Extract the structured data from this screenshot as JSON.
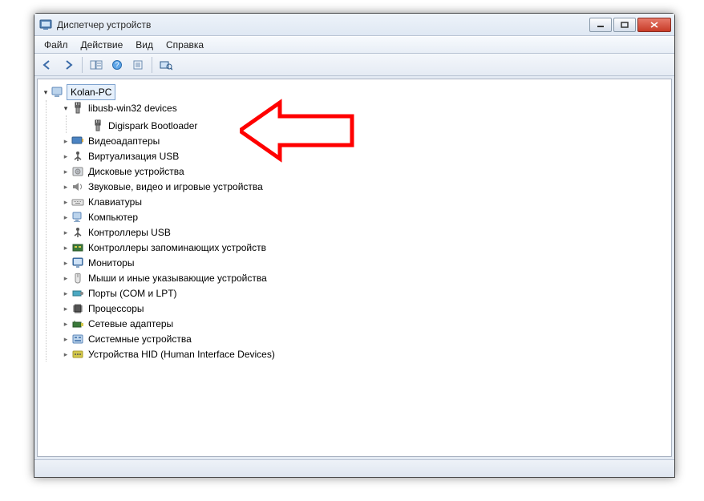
{
  "title": "Диспетчер устройств",
  "menu": {
    "file": "Файл",
    "action": "Действие",
    "view": "Вид",
    "help": "Справка"
  },
  "tree": {
    "root": "Kolan-PC",
    "items": [
      {
        "label": "libusb-win32 devices",
        "icon": "usb-plug-icon",
        "expanded": true,
        "children": [
          {
            "label": "Digispark Bootloader",
            "icon": "usb-plug-icon"
          }
        ]
      },
      {
        "label": "Видеоадаптеры",
        "icon": "display-adapter-icon"
      },
      {
        "label": "Виртуализация USB",
        "icon": "usb-controller-icon"
      },
      {
        "label": "Дисковые устройства",
        "icon": "disk-drive-icon"
      },
      {
        "label": "Звуковые, видео и игровые устройства",
        "icon": "sound-icon"
      },
      {
        "label": "Клавиатуры",
        "icon": "keyboard-icon"
      },
      {
        "label": "Компьютер",
        "icon": "computer-icon"
      },
      {
        "label": "Контроллеры USB",
        "icon": "usb-controller-icon"
      },
      {
        "label": "Контроллеры запоминающих устройств",
        "icon": "storage-controller-icon"
      },
      {
        "label": "Мониторы",
        "icon": "monitor-icon"
      },
      {
        "label": "Мыши и иные указывающие устройства",
        "icon": "mouse-icon"
      },
      {
        "label": "Порты (COM и LPT)",
        "icon": "ports-icon"
      },
      {
        "label": "Процессоры",
        "icon": "processor-icon"
      },
      {
        "label": "Сетевые адаптеры",
        "icon": "network-adapter-icon"
      },
      {
        "label": "Системные устройства",
        "icon": "system-device-icon"
      },
      {
        "label": "Устройства HID (Human Interface Devices)",
        "icon": "hid-icon"
      }
    ]
  }
}
